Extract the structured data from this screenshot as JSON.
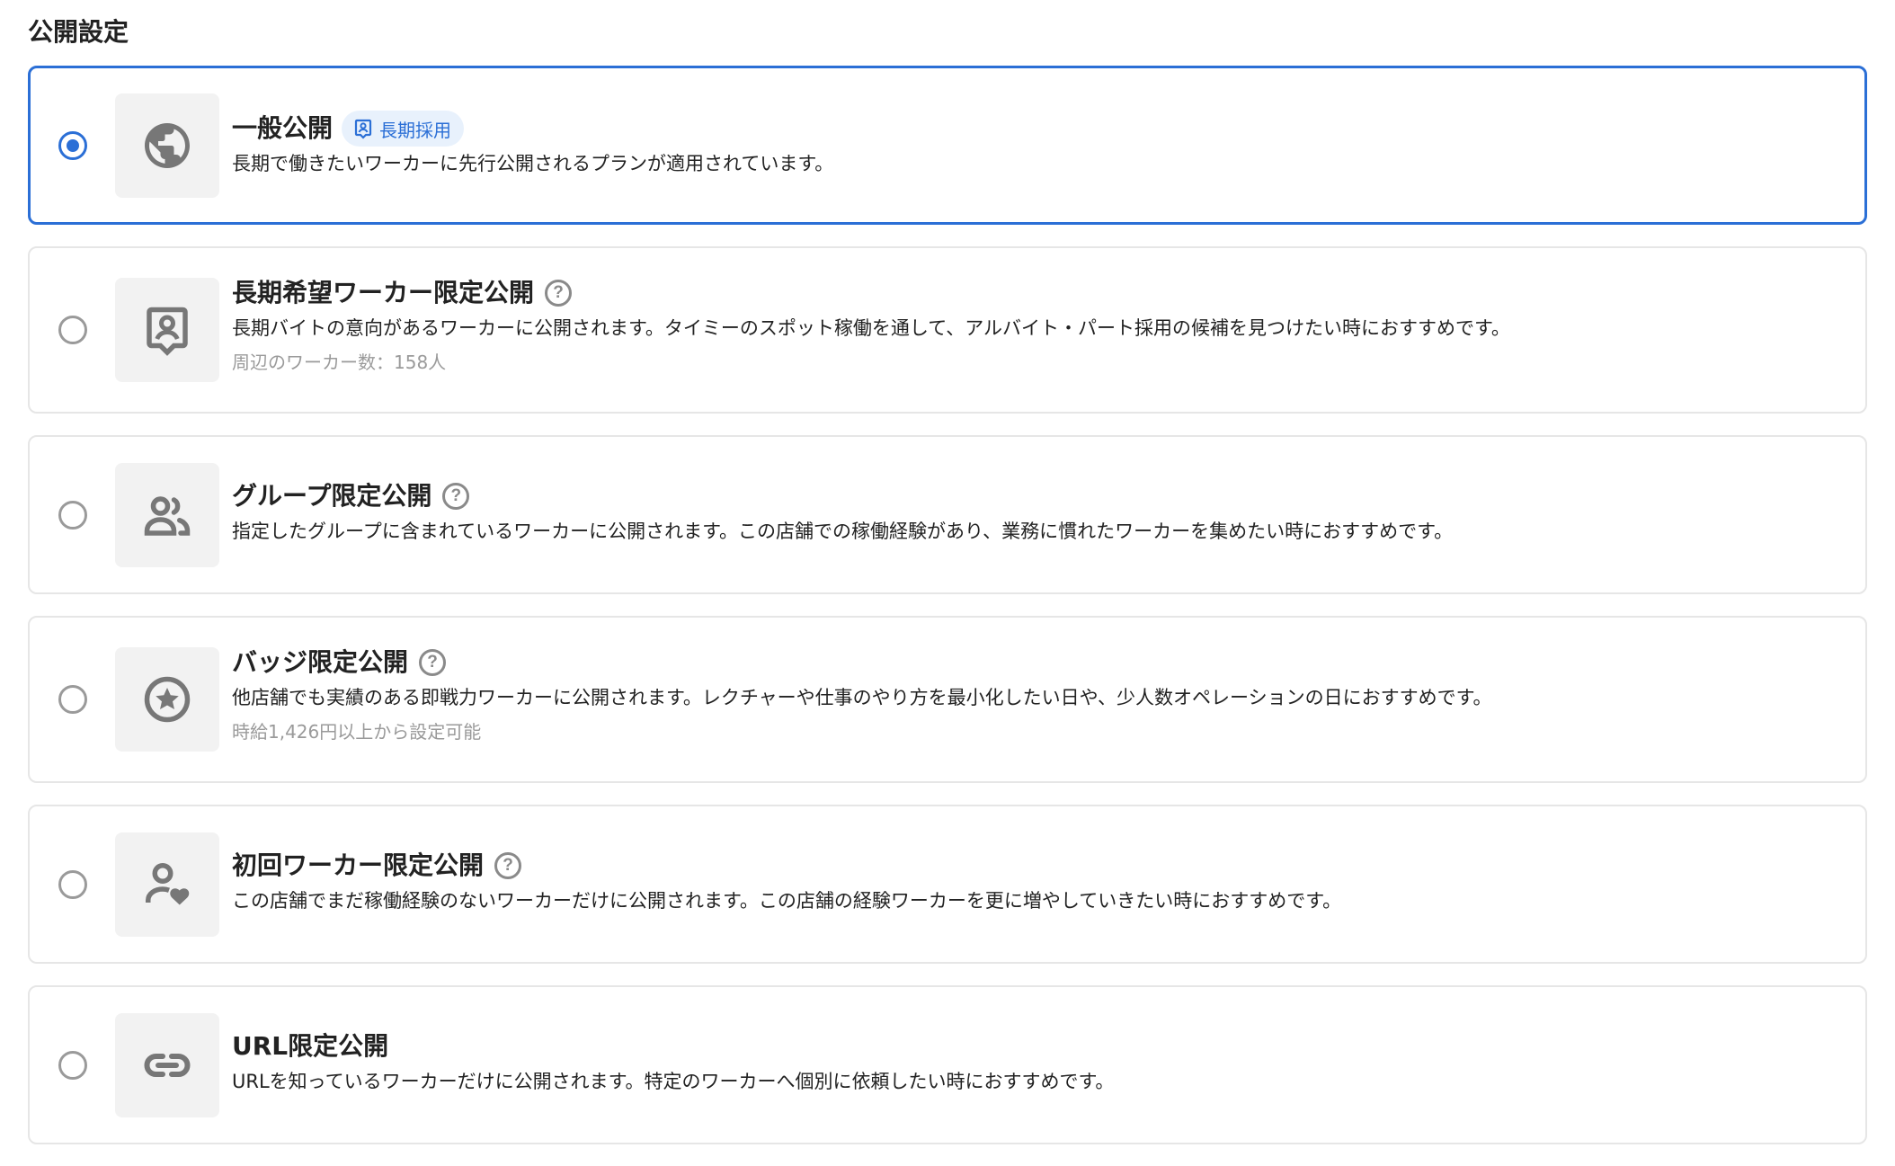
{
  "section": {
    "title": "公開設定"
  },
  "colors": {
    "accent": "#2b6fd6",
    "badge_bg": "#e8f1fc",
    "border": "#e6e6e6",
    "icon_bg": "#f2f2f2",
    "muted": "#9a9a9a"
  },
  "options": [
    {
      "title": "一般公開",
      "badge": "長期採用",
      "description": "長期で働きたいワーカーに先行公開されるプランが適用されています。",
      "icon": "globe-icon",
      "selected": true
    },
    {
      "title": "長期希望ワーカー限定公開",
      "description": "長期バイトの意向があるワーカーに公開されます。タイミーのスポット稼働を通して、アルバイト・パート採用の候補を見つけたい時におすすめです。",
      "note": "周辺のワーカー数：158人",
      "icon": "worker-id-icon",
      "help": "?",
      "selected": false
    },
    {
      "title": "グループ限定公開",
      "description": "指定したグループに含まれているワーカーに公開されます。この店舗での稼働経験があり、業務に慣れたワーカーを集めたい時におすすめです。",
      "icon": "group-icon",
      "help": "?",
      "selected": false
    },
    {
      "title": "バッジ限定公開",
      "description": "他店舗でも実績のある即戦力ワーカーに公開されます。レクチャーや仕事のやり方を最小化したい日や、少人数オペレーションの日におすすめです。",
      "note": "時給1,426円以上から設定可能",
      "icon": "star-badge-icon",
      "help": "?",
      "selected": false
    },
    {
      "title": "初回ワーカー限定公開",
      "description": "この店舗でまだ稼働経験のないワーカーだけに公開されます。この店舗の経験ワーカーを更に増やしていきたい時におすすめです。",
      "icon": "person-heart-icon",
      "help": "?",
      "selected": false
    },
    {
      "title": "URL限定公開",
      "description": "URLを知っているワーカーだけに公開されます。特定のワーカーへ個別に依頼したい時におすすめです。",
      "icon": "link-icon",
      "selected": false
    }
  ]
}
